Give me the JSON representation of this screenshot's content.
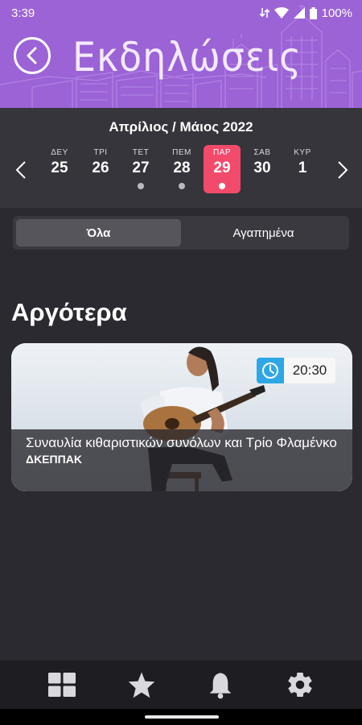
{
  "status_bar": {
    "time": "3:39",
    "battery": "100%"
  },
  "header": {
    "title": "Εκδηλώσεις"
  },
  "calendar": {
    "month_label": "Απρίλιος / Μάιος 2022",
    "days": [
      {
        "name": "ΔΕΥ",
        "number": "25",
        "has_events": false,
        "selected": false
      },
      {
        "name": "ΤΡΙ",
        "number": "26",
        "has_events": false,
        "selected": false
      },
      {
        "name": "ΤΕΤ",
        "number": "27",
        "has_events": true,
        "selected": false
      },
      {
        "name": "ΠΕΜ",
        "number": "28",
        "has_events": true,
        "selected": false
      },
      {
        "name": "ΠΑΡ",
        "number": "29",
        "has_events": true,
        "selected": true
      },
      {
        "name": "ΣΑΒ",
        "number": "30",
        "has_events": false,
        "selected": false
      },
      {
        "name": "ΚΥΡ",
        "number": "1",
        "has_events": false,
        "selected": false
      }
    ]
  },
  "tabs": [
    {
      "label": "Όλα",
      "active": true
    },
    {
      "label": "Αγαπημένα",
      "active": false
    }
  ],
  "section": {
    "title": "Αργότερα"
  },
  "events": [
    {
      "time": "20:30",
      "title": "Συναυλία κιθαριστικών συνόλων και Τρίο Φλαμένκο",
      "venue": "ΔΚΕΠΠΑΚ"
    }
  ],
  "bottom_nav": [
    {
      "icon": "grid-icon"
    },
    {
      "icon": "star-icon"
    },
    {
      "icon": "bell-icon"
    },
    {
      "icon": "gear-icon"
    }
  ],
  "colors": {
    "header": "#9b63d6",
    "accent": "#f24a6b",
    "background": "#2b2a30",
    "clock_badge": "#2ea7e6"
  }
}
